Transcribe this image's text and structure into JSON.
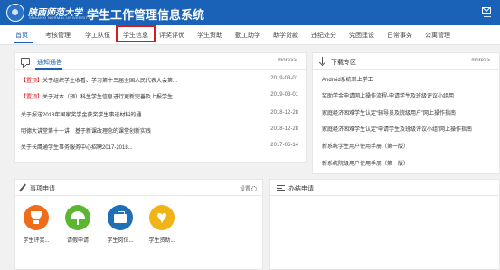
{
  "header": {
    "university_name": "陕西师范大学",
    "university_name_en": "SHAANXI NORMAL UNIVERSITY",
    "system_title": "学生工作管理信息系统"
  },
  "nav": {
    "items": [
      {
        "label": "首页",
        "active": true
      },
      {
        "label": "考核管理"
      },
      {
        "label": "学工队伍"
      },
      {
        "label": "学生信息",
        "highlighted": true
      },
      {
        "label": "评奖评优"
      },
      {
        "label": "学生资助"
      },
      {
        "label": "勤工助学"
      },
      {
        "label": "助学贷款"
      },
      {
        "label": "违纪处分"
      },
      {
        "label": "党团建设"
      },
      {
        "label": "日常事务"
      },
      {
        "label": "公寓管理"
      }
    ]
  },
  "notice": {
    "tab": "通知通告",
    "more": "more>>",
    "rows": [
      {
        "tag": "【置顶】",
        "title": "关于组织学生收看、学习第十三届全国人民代表大会第...",
        "date": "2019-03-01"
      },
      {
        "tag": "【置顶】",
        "title": "关于对本（预）科生学生信息进行更新完善及上报学生...",
        "date": "2019-03-01"
      },
      {
        "tag": "",
        "title": "关于报送2018年国家奖学金获奖学生事迹材料的通...",
        "date": "2018-12-28"
      },
      {
        "tag": "",
        "title": "明德大讲堂第十一讲：基于新课改理念的课堂创新实践",
        "date": "2018-12-28"
      },
      {
        "tag": "",
        "title": "关于长鹰通学生事务服务中心招聘2017-2018...",
        "date": "2017-06-14"
      }
    ]
  },
  "download": {
    "title": "下载专区",
    "more": "more>>",
    "rows": [
      "Android系统掌上学工",
      "奖助学金申请网上操作流程-申请学生及班级评议小组用",
      "家庭经济困难学生认定“辅导员及院级用户”网上操作指南",
      "家庭经济困难学生认定“申请学生及班级评议小组”网上操作指南",
      "新系统学生用户使用手册（第一版）",
      "新系统院级用户使用手册（第一版）"
    ]
  },
  "apply": {
    "title": "事项申请",
    "settings": "设置",
    "apps": [
      {
        "label": "学生评奖...",
        "color": "#ef6c1b",
        "icon": "trophy-icon"
      },
      {
        "label": "请假申请",
        "color": "#5cb631",
        "icon": "umbrella-icon"
      },
      {
        "label": "学生岗位...",
        "color": "#1e6fb8",
        "icon": "briefcase-icon"
      },
      {
        "label": "学生资助...",
        "color": "#f0b416",
        "icon": "heart-icon"
      }
    ]
  },
  "todo": {
    "title": "办结申请"
  }
}
